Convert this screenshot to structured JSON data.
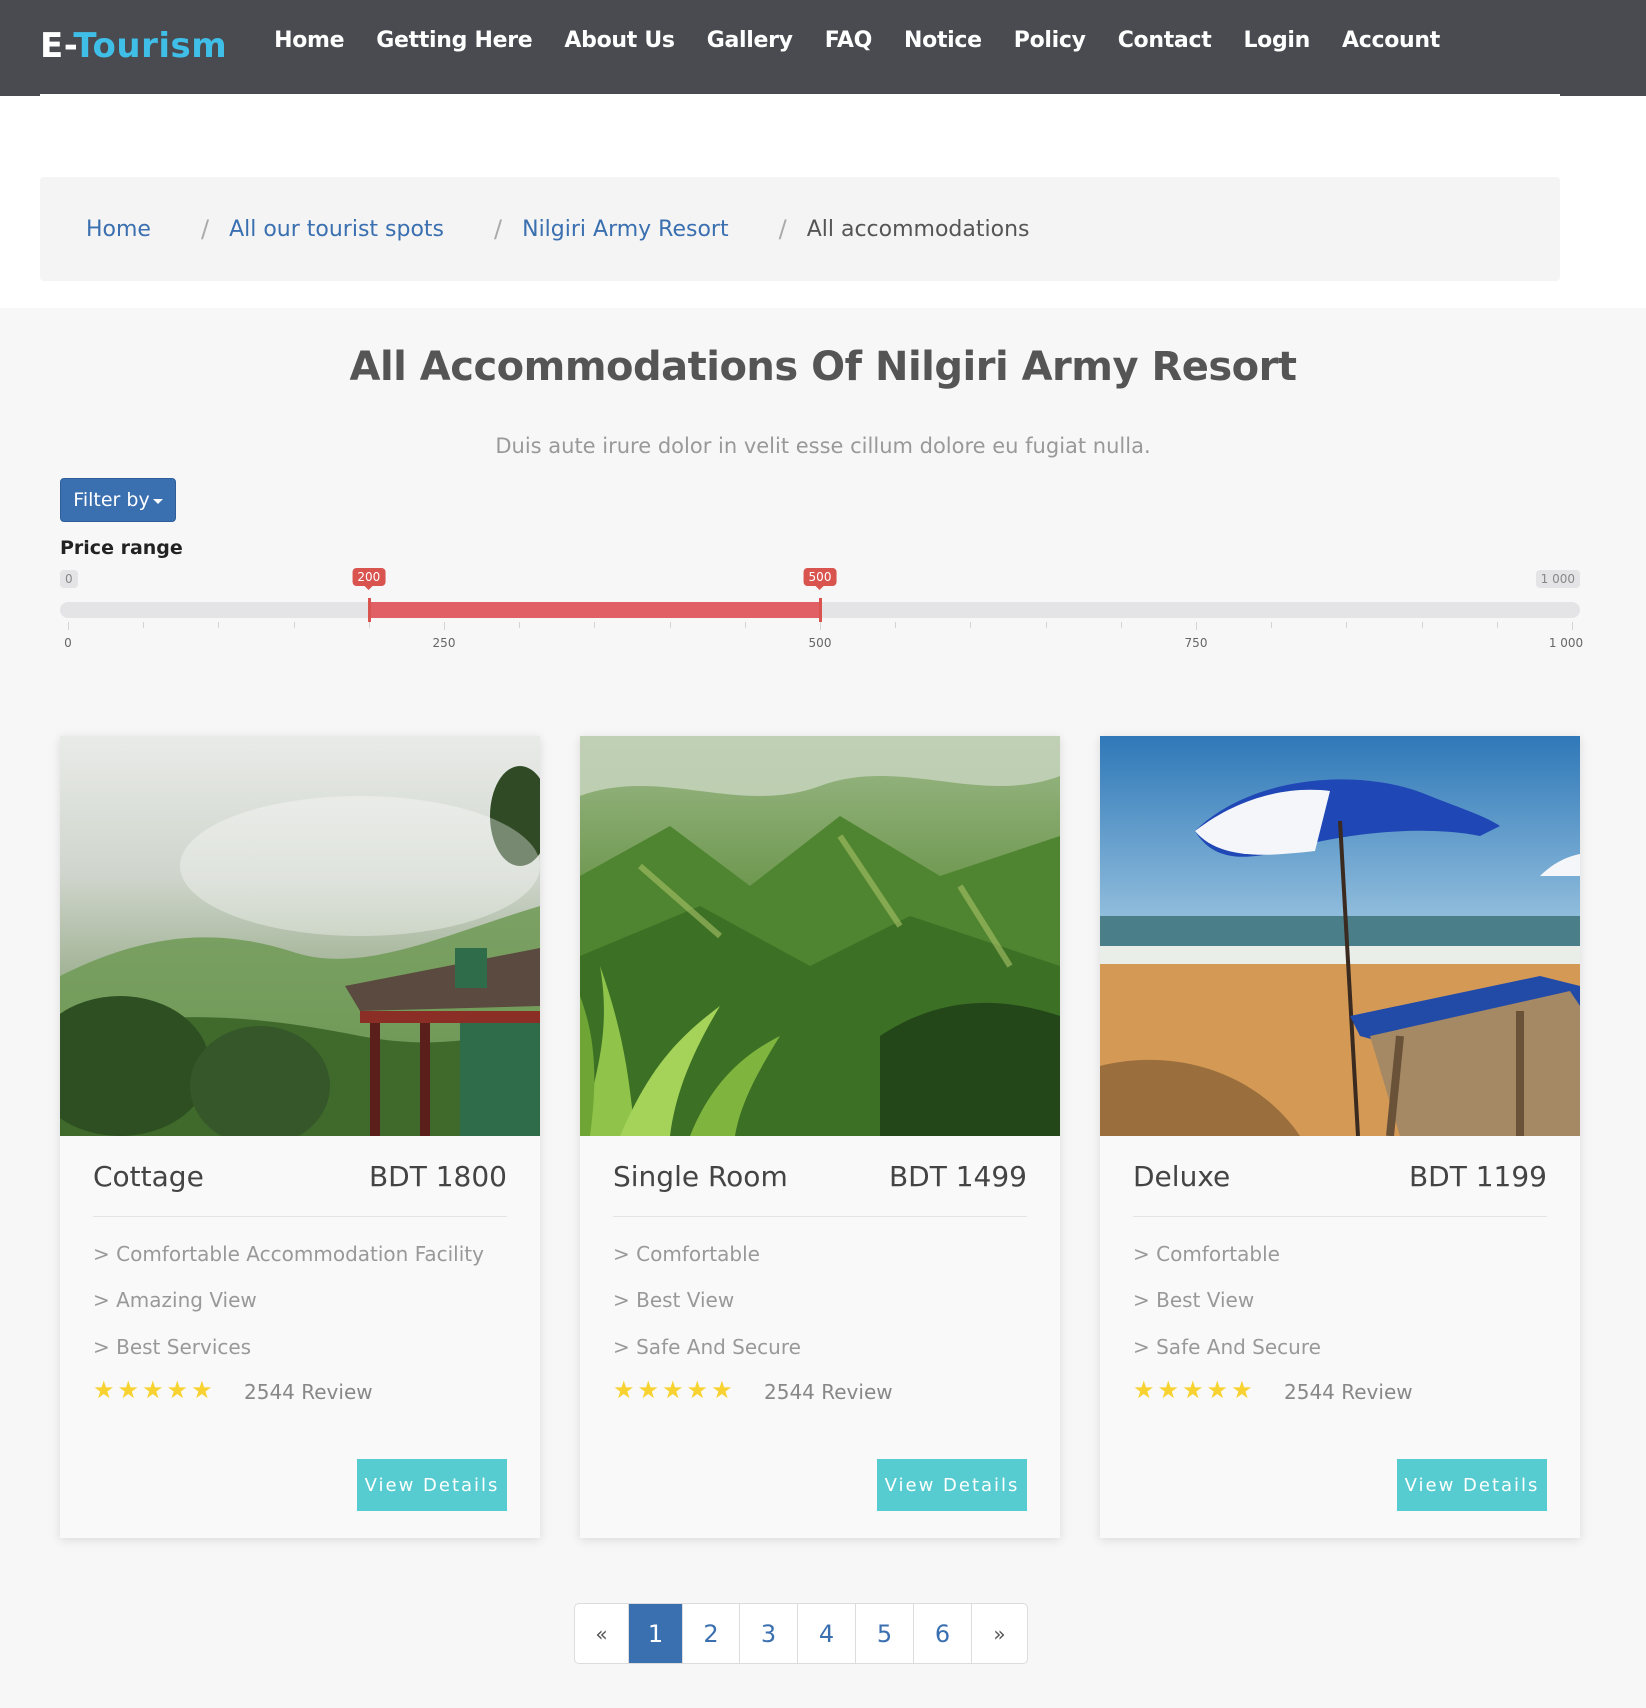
{
  "brand": {
    "prefix": "E-",
    "name": "Tourism",
    "accent_color": "#3fbfe8"
  },
  "nav": {
    "items": [
      "Home",
      "Getting Here",
      "About Us",
      "Gallery",
      "FAQ",
      "Notice",
      "Policy",
      "Contact",
      "Login",
      "Account"
    ],
    "background": "#4a4b50"
  },
  "breadcrumb": {
    "items": [
      {
        "label": "Home",
        "link": true
      },
      {
        "label": "All our tourist spots",
        "link": true
      },
      {
        "label": "Nilgiri Army Resort",
        "link": true
      },
      {
        "label": "All accommodations",
        "link": false
      }
    ],
    "separator": "/"
  },
  "page": {
    "title": "All Accommodations Of Nilgiri Army Resort",
    "subtitle": "Duis aute irure dolor in velit esse cillum dolore eu fugiat nulla."
  },
  "filter": {
    "button_label": "Filter by",
    "price_label": "Price range",
    "slider": {
      "min": 0,
      "max": 1000,
      "min_label": "0",
      "max_label": "1 000",
      "low": 200,
      "high": 500,
      "low_label": "200",
      "high_label": "500",
      "tick_labels": [
        "0",
        "250",
        "500",
        "750",
        "1 000"
      ],
      "fill_color": "#e06066"
    }
  },
  "accommodations": [
    {
      "name": "Cottage",
      "price": "BDT 1800",
      "image": "misty-hills-cottage",
      "features": [
        "> Comfortable Accommodation Facility",
        "> Amazing View",
        "> Best Services"
      ],
      "rating": 5,
      "reviews": "2544 Review",
      "button": "View Details"
    },
    {
      "name": "Single Room",
      "price": "BDT 1499",
      "image": "green-mountains",
      "features": [
        "> Comfortable",
        "> Best View",
        "> Safe And Secure"
      ],
      "rating": 5,
      "reviews": "2544 Review",
      "button": "View Details"
    },
    {
      "name": "Deluxe",
      "price": "BDT 1199",
      "image": "beach-umbrella",
      "features": [
        "> Comfortable",
        "> Best View",
        "> Safe And Secure"
      ],
      "rating": 5,
      "reviews": "2544 Review",
      "button": "View Details"
    }
  ],
  "pagination": {
    "prev": "«",
    "next": "»",
    "pages": [
      "1",
      "2",
      "3",
      "4",
      "5",
      "6"
    ],
    "active": "1"
  },
  "colors": {
    "link": "#3a6fb0",
    "star": "#f7d230",
    "button": "#56ccd0",
    "range": "#d9534f"
  }
}
